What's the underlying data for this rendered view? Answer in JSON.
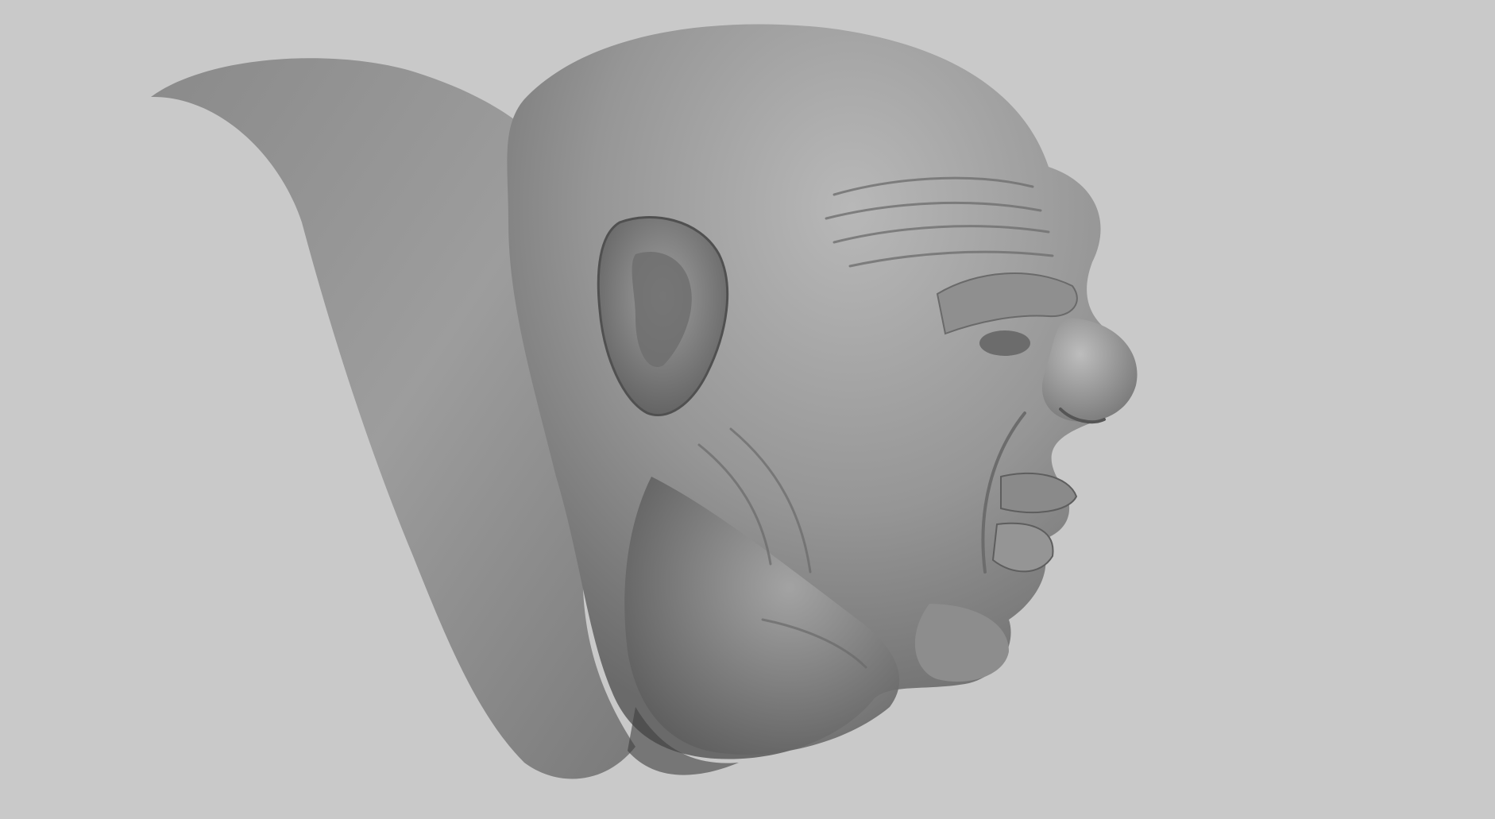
{
  "scene": {
    "subject": "sculpted-head-model",
    "colors": {
      "background": "#c9c9c9",
      "clay_light": "#b4b4b4",
      "clay_mid": "#8c8c8c",
      "clay_dark": "#4a4a4a"
    }
  }
}
